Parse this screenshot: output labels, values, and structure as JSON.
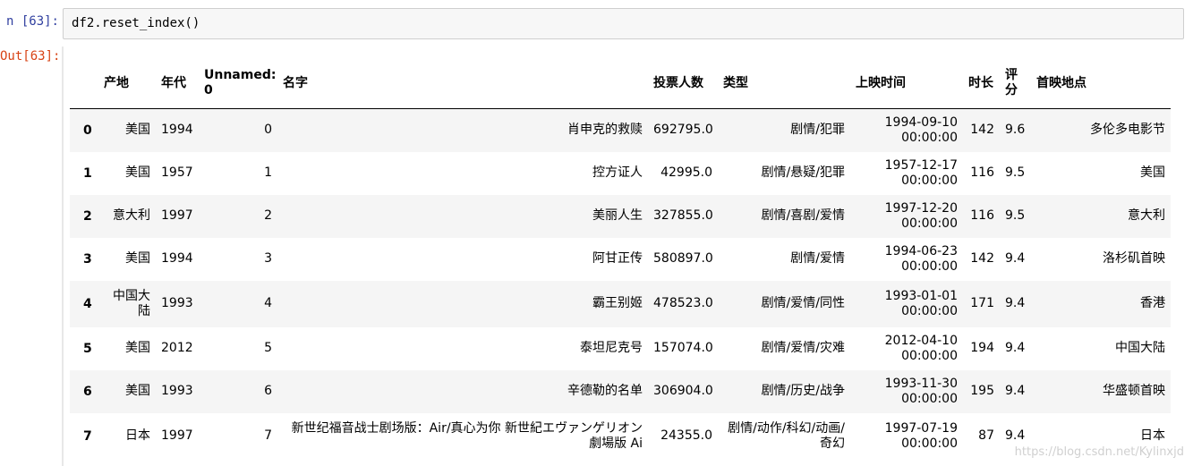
{
  "cell": {
    "in_prompt": "n [63]:",
    "out_prompt": "Out[63]:",
    "code": "df2.reset_index()"
  },
  "table": {
    "columns": [
      "",
      "产地",
      "年代",
      "Unnamed: 0",
      "名字",
      "投票人数",
      "类型",
      "上映时间",
      "时长",
      "评分",
      "首映地点"
    ],
    "rows": [
      {
        "index": "0",
        "cells": [
          "美国",
          "1994",
          "0",
          "肖申克的救赎",
          "692795.0",
          "剧情/犯罪",
          "1994-09-10 00:00:00",
          "142",
          "9.6",
          "多伦多电影节"
        ]
      },
      {
        "index": "1",
        "cells": [
          "美国",
          "1957",
          "1",
          "控方证人",
          "42995.0",
          "剧情/悬疑/犯罪",
          "1957-12-17 00:00:00",
          "116",
          "9.5",
          "美国"
        ]
      },
      {
        "index": "2",
        "cells": [
          "意大利",
          "1997",
          "2",
          "美丽人生",
          "327855.0",
          "剧情/喜剧/爱情",
          "1997-12-20 00:00:00",
          "116",
          "9.5",
          "意大利"
        ]
      },
      {
        "index": "3",
        "cells": [
          "美国",
          "1994",
          "3",
          "阿甘正传",
          "580897.0",
          "剧情/爱情",
          "1994-06-23 00:00:00",
          "142",
          "9.4",
          "洛杉矶首映"
        ]
      },
      {
        "index": "4",
        "cells": [
          "中国大陆",
          "1993",
          "4",
          "霸王别姬",
          "478523.0",
          "剧情/爱情/同性",
          "1993-01-01 00:00:00",
          "171",
          "9.4",
          "香港"
        ]
      },
      {
        "index": "5",
        "cells": [
          "美国",
          "2012",
          "5",
          "泰坦尼克号",
          "157074.0",
          "剧情/爱情/灾难",
          "2012-04-10 00:00:00",
          "194",
          "9.4",
          "中国大陆"
        ]
      },
      {
        "index": "6",
        "cells": [
          "美国",
          "1993",
          "6",
          "辛德勒的名单",
          "306904.0",
          "剧情/历史/战争",
          "1993-11-30 00:00:00",
          "195",
          "9.4",
          "华盛顿首映"
        ]
      },
      {
        "index": "7",
        "cells": [
          "日本",
          "1997",
          "7",
          "新世纪福音战士剧场版：Air/真心为你 新世紀エヴァンゲリオン劇場版 Ai",
          "24355.0",
          "剧情/动作/科幻/动画/奇幻",
          "1997-07-19 00:00:00",
          "87",
          "9.4",
          "日本"
        ]
      }
    ]
  },
  "watermark": "https://blog.csdn.net/Kylinxjd"
}
